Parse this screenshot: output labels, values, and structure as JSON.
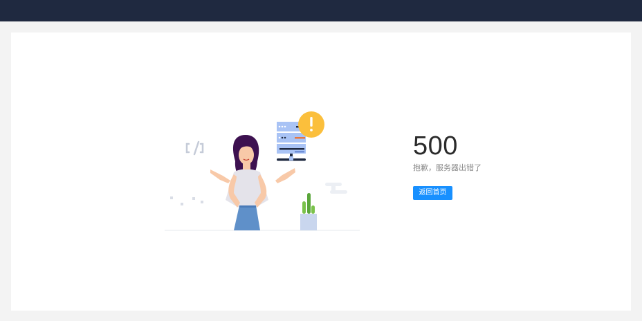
{
  "header": {
    "background_color": "#1f2940"
  },
  "error": {
    "code": "500",
    "message": "抱歉，服务器出错了",
    "home_button_label": "返回首页"
  },
  "colors": {
    "accent": "#1890ff",
    "warning": "#fbbf3c"
  },
  "illustration": {
    "icons": [
      "code-tag-icon",
      "server-icon",
      "warning-icon",
      "cactus-icon"
    ]
  }
}
